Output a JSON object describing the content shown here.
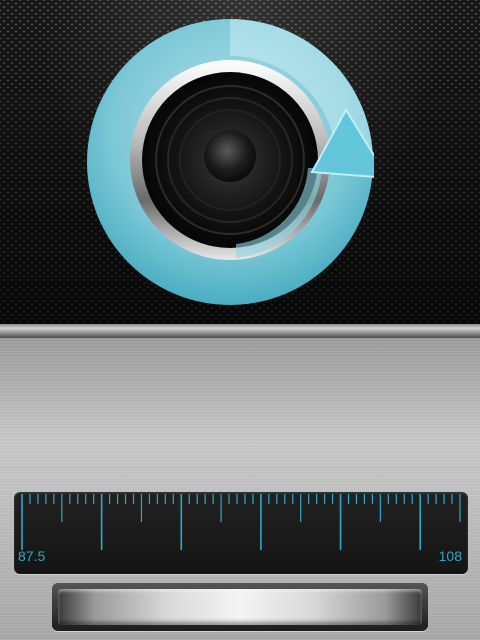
{
  "tuner": {
    "min_label": "87.5",
    "max_label": "108",
    "min_value": 87.5,
    "max_value": 108
  },
  "icons": {
    "speaker": "speaker-icon",
    "refresh_arrow": "refresh-arrow-icon"
  },
  "colors": {
    "accent": "#5fc3d6",
    "scale_text": "#2fa8c8",
    "scale_bg": "#161616"
  }
}
